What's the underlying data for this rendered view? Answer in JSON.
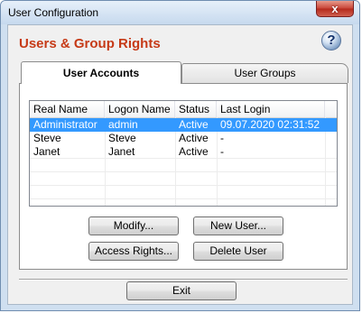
{
  "window": {
    "title": "User Configuration",
    "close_glyph": "x"
  },
  "heading": "Users & Group Rights",
  "help_glyph": "?",
  "tabs": [
    {
      "label": "User Accounts",
      "active": true
    },
    {
      "label": "User Groups",
      "active": false
    }
  ],
  "table": {
    "columns": [
      "Real Name",
      "Logon Name",
      "Status",
      "Last Login"
    ],
    "rows": [
      {
        "real_name": "Administrator",
        "logon_name": "admin",
        "status": "Active",
        "last_login": "09.07.2020 02:31:52",
        "selected": true
      },
      {
        "real_name": "Steve",
        "logon_name": "Steve",
        "status": "Active",
        "last_login": "-",
        "selected": false
      },
      {
        "real_name": "Janet",
        "logon_name": "Janet",
        "status": "Active",
        "last_login": "-",
        "selected": false
      }
    ]
  },
  "buttons": {
    "modify": "Modify...",
    "new_user": "New User...",
    "access_rights": "Access Rights...",
    "delete_user": "Delete User",
    "exit": "Exit"
  },
  "colors": {
    "heading": "#c63a17",
    "selection": "#3399ff",
    "close_button": "#c9473a"
  },
  "icons": {
    "help": "help-question-icon",
    "close": "close-icon"
  }
}
